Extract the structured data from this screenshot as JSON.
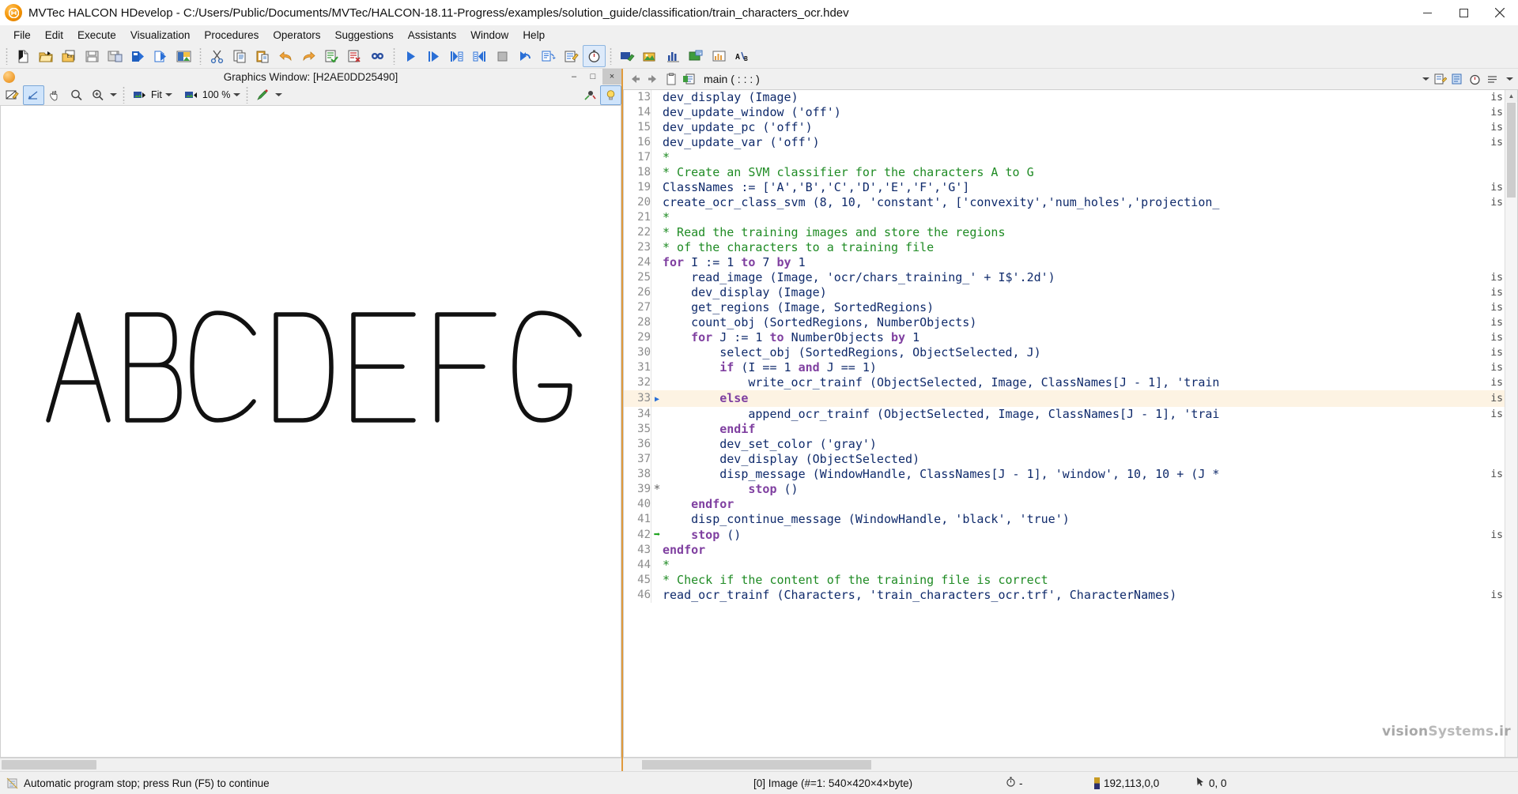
{
  "window": {
    "title": "MVTec HALCON HDevelop - C:/Users/Public/Documents/MVTec/HALCON-18.11-Progress/examples/solution_guide/classification/train_characters_ocr.hdev",
    "logo_text": "Hb",
    "minimize_label": "Minimize",
    "maximize_label": "Maximize",
    "close_label": "Close"
  },
  "menubar": {
    "items": [
      {
        "label": "File"
      },
      {
        "label": "Edit"
      },
      {
        "label": "Execute"
      },
      {
        "label": "Visualization"
      },
      {
        "label": "Procedures"
      },
      {
        "label": "Operators"
      },
      {
        "label": "Suggestions"
      },
      {
        "label": "Assistants"
      },
      {
        "label": "Window"
      },
      {
        "label": "Help"
      }
    ]
  },
  "toolbar": {
    "groups": [
      [
        "new-program-icon",
        "open-program-icon",
        "open-example-icon",
        "save-program-icon",
        "save-as-icon",
        "export-icon",
        "import-icon",
        "image-acquisition-icon"
      ],
      [
        "cut-icon",
        "copy-icon",
        "paste-icon",
        "undo-icon",
        "redo-icon",
        "activate-code-icon",
        "deactivate-code-icon",
        "find-icon"
      ],
      [
        "run-icon",
        "step-over-icon",
        "step-into-icon",
        "step-out-icon",
        "stop-icon",
        "reset-program-icon",
        "continue-icon",
        "insert-operator-icon",
        "profiling-icon"
      ],
      [
        "clear-window-icon",
        "image-variables-icon",
        "histogram-icon",
        "region-icon",
        "feature-histogram-icon",
        "text-compare-icon"
      ]
    ]
  },
  "graphics_window": {
    "title": "Graphics Window: [H2AE0DD25490]",
    "minimize_label": "–",
    "maximize_label": "□",
    "close_label": "×",
    "toolbar": {
      "draw_mode_icon": "draw-mode-icon",
      "select_icon": "select-tool-icon",
      "pan_icon": "pan-hand-icon",
      "zoom_icon": "magnifier-icon",
      "zoom_in_icon": "zoom-in-icon",
      "zoom_dropdown_icon": "chevron-down-icon",
      "fit_icon": "fit-image-icon",
      "fit_label": "Fit",
      "fit_dropdown_icon": "chevron-down-icon",
      "scale_icon": "scale-image-icon",
      "scale_label": "100 %",
      "scale_dropdown_icon": "chevron-down-icon",
      "color_icon": "color-palette-icon",
      "color_dropdown_icon": "chevron-down-icon",
      "right_icons": [
        "measure-pin-icon",
        "lightbulb-icon"
      ]
    },
    "content_label": "ABCDEFG"
  },
  "code_editor": {
    "back_icon": "back-arrow-icon",
    "forward_icon": "forward-arrow-icon",
    "clipboard_icon": "clipboard-icon",
    "procedure_icon": "procedure-icon",
    "procedure_name": "main ( : : : )",
    "dropdown_icon": "chevron-down-icon",
    "right_icons": [
      "new-procedure-icon",
      "edit-procedure-icon",
      "timing-icon",
      "settings-icon",
      "more-icon"
    ],
    "lines": [
      {
        "n": "13",
        "marker": "",
        "indent": 0,
        "text": "dev_display (Image)",
        "type": "code",
        "hl": false,
        "is": true
      },
      {
        "n": "14",
        "marker": "",
        "indent": 0,
        "text": "dev_update_window ('off')",
        "type": "code",
        "hl": false,
        "is": true
      },
      {
        "n": "15",
        "marker": "",
        "indent": 0,
        "text": "dev_update_pc ('off')",
        "type": "code",
        "hl": false,
        "is": true
      },
      {
        "n": "16",
        "marker": "",
        "indent": 0,
        "text": "dev_update_var ('off')",
        "type": "code",
        "hl": false,
        "is": true
      },
      {
        "n": "17",
        "marker": "",
        "indent": 0,
        "text": "*",
        "type": "comment",
        "hl": false,
        "is": false
      },
      {
        "n": "18",
        "marker": "",
        "indent": 0,
        "text": "* Create an SVM classifier for the characters A to G",
        "type": "comment",
        "hl": false,
        "is": false
      },
      {
        "n": "19",
        "marker": "",
        "indent": 0,
        "text": "ClassNames := ['A','B','C','D','E','F','G']",
        "type": "code",
        "hl": false,
        "is": true
      },
      {
        "n": "20",
        "marker": "",
        "indent": 0,
        "text": "create_ocr_class_svm (8, 10, 'constant', ['convexity','num_holes','projection_",
        "type": "code",
        "hl": false,
        "is": true
      },
      {
        "n": "21",
        "marker": "",
        "indent": 0,
        "text": "*",
        "type": "comment",
        "hl": false,
        "is": false
      },
      {
        "n": "22",
        "marker": "",
        "indent": 0,
        "text": "* Read the training images and store the regions",
        "type": "comment",
        "hl": false,
        "is": false
      },
      {
        "n": "23",
        "marker": "",
        "indent": 0,
        "text": "* of the characters to a training file",
        "type": "comment",
        "hl": false,
        "is": false
      },
      {
        "n": "24",
        "marker": "",
        "indent": 0,
        "text": "for I := 1 to 7 by 1",
        "type": "kwline",
        "hl": false,
        "is": false
      },
      {
        "n": "25",
        "marker": "",
        "indent": 1,
        "text": "read_image (Image, 'ocr/chars_training_' + I$'.2d')",
        "type": "code",
        "hl": false,
        "is": true
      },
      {
        "n": "26",
        "marker": "",
        "indent": 1,
        "text": "dev_display (Image)",
        "type": "code",
        "hl": false,
        "is": true
      },
      {
        "n": "27",
        "marker": "",
        "indent": 1,
        "text": "get_regions (Image, SortedRegions)",
        "type": "call",
        "hl": false,
        "is": true
      },
      {
        "n": "28",
        "marker": "",
        "indent": 1,
        "text": "count_obj (SortedRegions, NumberObjects)",
        "type": "code",
        "hl": false,
        "is": true
      },
      {
        "n": "29",
        "marker": "",
        "indent": 1,
        "text": "for J := 1 to NumberObjects by 1",
        "type": "kwline",
        "hl": false,
        "is": true
      },
      {
        "n": "30",
        "marker": "",
        "indent": 2,
        "text": "select_obj (SortedRegions, ObjectSelected, J)",
        "type": "code",
        "hl": false,
        "is": true
      },
      {
        "n": "31",
        "marker": "",
        "indent": 2,
        "text": "if (I == 1 and J == 1)",
        "type": "kwline",
        "hl": false,
        "is": true
      },
      {
        "n": "32",
        "marker": "",
        "indent": 3,
        "text": "write_ocr_trainf (ObjectSelected, Image, ClassNames[J - 1], 'train",
        "type": "code",
        "hl": false,
        "is": true
      },
      {
        "n": "33",
        "marker": "▶",
        "indent": 2,
        "text": "else",
        "type": "kwline",
        "hl": true,
        "is": true
      },
      {
        "n": "34",
        "marker": "",
        "indent": 3,
        "text": "append_ocr_trainf (ObjectSelected, Image, ClassNames[J - 1], 'trai",
        "type": "code",
        "hl": false,
        "is": true
      },
      {
        "n": "35",
        "marker": "",
        "indent": 2,
        "text": "endif",
        "type": "kwline",
        "hl": false,
        "is": false
      },
      {
        "n": "36",
        "marker": "",
        "indent": 2,
        "text": "dev_set_color ('gray')",
        "type": "code",
        "hl": false,
        "is": false
      },
      {
        "n": "37",
        "marker": "",
        "indent": 2,
        "text": "dev_display (ObjectSelected)",
        "type": "code",
        "hl": false,
        "is": false
      },
      {
        "n": "38",
        "marker": "",
        "indent": 2,
        "text": "disp_message (WindowHandle, ClassNames[J - 1], 'window', 10, 10 + (J *",
        "type": "call",
        "hl": false,
        "is": true
      },
      {
        "n": "39",
        "marker": "*",
        "indent": 3,
        "text": "stop ()",
        "type": "code",
        "hl": false,
        "is": false
      },
      {
        "n": "40",
        "marker": "",
        "indent": 1,
        "text": "endfor",
        "type": "kwline",
        "hl": false,
        "is": false
      },
      {
        "n": "41",
        "marker": "",
        "indent": 1,
        "text": "disp_continue_message (WindowHandle, 'black', 'true')",
        "type": "call",
        "hl": false,
        "is": false
      },
      {
        "n": "42",
        "marker": "➜",
        "indent": 1,
        "text": "stop ()",
        "type": "code",
        "hl": false,
        "is": true
      },
      {
        "n": "43",
        "marker": "",
        "indent": 0,
        "text": "endfor",
        "type": "kwline",
        "hl": false,
        "is": false
      },
      {
        "n": "44",
        "marker": "",
        "indent": 0,
        "text": "*",
        "type": "comment",
        "hl": false,
        "is": false
      },
      {
        "n": "45",
        "marker": "",
        "indent": 0,
        "text": "* Check if the content of the training file is correct",
        "type": "comment",
        "hl": false,
        "is": false
      },
      {
        "n": "46",
        "marker": "",
        "indent": 0,
        "text": "read_ocr_trainf (Characters, 'train_characters_ocr.trf', CharacterNames)",
        "type": "code",
        "hl": false,
        "is": true
      }
    ],
    "is_marker": "is"
  },
  "watermark": {
    "text_a": "vision",
    "text_b": "Systems",
    "text_c": ".ir"
  },
  "statusbar": {
    "status_icon": "program-stop-icon",
    "message": "Automatic program stop; press Run (F5) to continue",
    "image_info": "[0] Image (#=1: 540×420×4×byte)",
    "clock_icon": "stopwatch-icon",
    "clock_value": "-",
    "color_icon": "color-swatch-icon",
    "color_value": "192,113,0,0",
    "cursor_icon": "cursor-icon",
    "cursor_value": "0, 0"
  },
  "colors": {
    "accent_orange": "#e09a3c",
    "comment_green": "#1f8b24",
    "keyword_purple": "#7f3fa0",
    "code_blue": "#0f2a6b",
    "highlight_row": "#fdf3e3",
    "titlebar": "#ffffff",
    "chrome": "#f0f0f0"
  }
}
